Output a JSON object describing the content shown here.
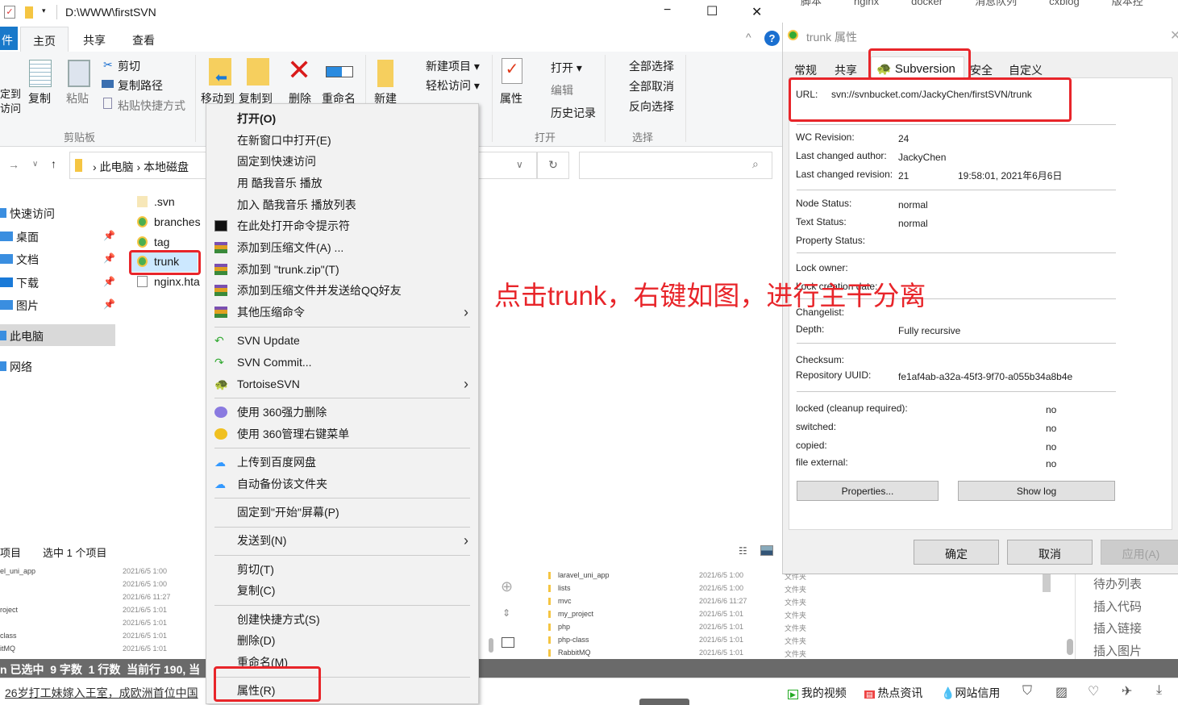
{
  "explorer": {
    "path_title": "D:\\WWW\\firstSVN",
    "window_controls": {
      "minimize": "−",
      "maximize": "☐",
      "close": "✕"
    },
    "tabs": [
      {
        "label": "件"
      },
      {
        "label": "主页"
      },
      {
        "label": "共享"
      },
      {
        "label": "查看"
      }
    ],
    "ribbon": {
      "pin_partial": "定到\n访问",
      "copy": "复制",
      "paste": "粘贴",
      "cut": "剪切",
      "copy_path": "复制路径",
      "paste_shortcut": "粘贴快捷方式",
      "clipboard_group": "剪贴板",
      "move_to": "移动到",
      "copy_to": "复制到",
      "delete": "删除",
      "rename": "重命名",
      "new_folder": "新建",
      "new_item": "新建项目 ▾",
      "easy_access": "轻松访问 ▾",
      "properties": "属性",
      "open": "打开 ▾",
      "edit": "编辑",
      "history": "历史记录",
      "open_group": "打开",
      "select_all": "全部选择",
      "select_none": "全部取消",
      "invert_selection": "反向选择",
      "select_group": "选择"
    },
    "address": {
      "crumbs": [
        "此电脑",
        "本地磁盘"
      ]
    },
    "nav": [
      {
        "label": "快速访问"
      },
      {
        "label": "桌面"
      },
      {
        "label": "文档"
      },
      {
        "label": "下载"
      },
      {
        "label": "图片"
      },
      {
        "label": "此电脑"
      },
      {
        "label": "网络"
      }
    ],
    "files": [
      {
        "name": ".svn"
      },
      {
        "name": "branches"
      },
      {
        "name": "tag"
      },
      {
        "name": "trunk"
      },
      {
        "name": "nginx.hta"
      }
    ],
    "status": {
      "items": "项目",
      "selected": "选中 1 个项目"
    }
  },
  "context_menu": [
    {
      "label": "打开(O)",
      "bold": true
    },
    {
      "label": "在新窗口中打开(E)"
    },
    {
      "label": "固定到快速访问"
    },
    {
      "label": "用 酷我音乐 播放"
    },
    {
      "label": "加入 酷我音乐 播放列表"
    },
    {
      "label": "在此处打开命令提示符",
      "icon": "cmd"
    },
    {
      "label": "添加到压缩文件(A) ...",
      "icon": "winrar"
    },
    {
      "label": "添加到 \"trunk.zip\"(T)",
      "icon": "winrar"
    },
    {
      "label": "添加到压缩文件并发送给QQ好友",
      "icon": "winrar"
    },
    {
      "label": "其他压缩命令",
      "icon": "winrar",
      "submenu": true
    },
    {
      "separator": true
    },
    {
      "label": "SVN Update",
      "icon": "svn-update"
    },
    {
      "label": "SVN Commit...",
      "icon": "svn-commit"
    },
    {
      "label": "TortoiseSVN",
      "icon": "tortoise",
      "submenu": true
    },
    {
      "separator": true
    },
    {
      "label": "使用 360强力删除",
      "icon": "360-delete"
    },
    {
      "label": "使用 360管理右键菜单",
      "icon": "360-plus"
    },
    {
      "separator": true
    },
    {
      "label": "上传到百度网盘",
      "icon": "baidu"
    },
    {
      "label": "自动备份该文件夹",
      "icon": "baidu"
    },
    {
      "separator": true
    },
    {
      "label": "固定到\"开始\"屏幕(P)"
    },
    {
      "separator": true
    },
    {
      "label": "发送到(N)",
      "submenu": true
    },
    {
      "separator": true
    },
    {
      "label": "剪切(T)"
    },
    {
      "label": "复制(C)"
    },
    {
      "separator": true
    },
    {
      "label": "创建快捷方式(S)"
    },
    {
      "label": "删除(D)"
    },
    {
      "label": "重命名(M)"
    },
    {
      "separator": true
    },
    {
      "label": "属性(R)"
    }
  ],
  "annotation": "点击trunk，右键如图，进行主干分离",
  "bookmarks": [
    "脚本",
    "nginx",
    "docker",
    "消息队列",
    "cxblog",
    "版本控"
  ],
  "properties_dialog": {
    "title": "trunk 属性",
    "tabs": [
      {
        "label": "常规"
      },
      {
        "label": "共享"
      },
      {
        "label": "Subversion"
      },
      {
        "label": "安全"
      },
      {
        "label": "自定义"
      }
    ],
    "url_label": "URL:",
    "url": "svn://svnbucket.com/JackyChen/firstSVN/trunk",
    "fields": {
      "wc_revision": {
        "label": "WC Revision:",
        "value": "24"
      },
      "last_author": {
        "label": "Last changed author:",
        "value": "JackyChen"
      },
      "last_revision": {
        "label": "Last changed revision:",
        "value": "21",
        "date": "19:58:01, 2021年6月6日"
      },
      "node_status": {
        "label": "Node Status:",
        "value": "normal"
      },
      "text_status": {
        "label": "Text Status:",
        "value": "normal"
      },
      "property_status": {
        "label": "Property Status:"
      },
      "lock_owner": {
        "label": "Lock owner:"
      },
      "lock_date": {
        "label": "Lock creation date:"
      },
      "changelist": {
        "label": "Changelist:"
      },
      "depth": {
        "label": "Depth:",
        "value": "Fully recursive"
      },
      "checksum": {
        "label": "Checksum:"
      },
      "uuid": {
        "label": "Repository UUID:",
        "value": "fe1af4ab-a32a-45f3-9f70-a055b34a8b4e"
      },
      "locked": {
        "label": "locked (cleanup required):",
        "value": "no"
      },
      "switched": {
        "label": "switched:",
        "value": "no"
      },
      "copied": {
        "label": "copied:",
        "value": "no"
      },
      "file_external": {
        "label": "file external:",
        "value": "no"
      }
    },
    "properties_button": "Properties...",
    "show_log_button": "Show log",
    "ok": "确定",
    "cancel": "取消",
    "apply": "应用(A)"
  },
  "background_left_list": [
    {
      "name": "el_uni_app",
      "date": "2021/6/5 1:00"
    },
    {
      "name": "",
      "date": "2021/6/5 1:00"
    },
    {
      "name": "",
      "date": "2021/6/6 11:27"
    },
    {
      "name": "roject",
      "date": "2021/6/5 1:01"
    },
    {
      "name": "",
      "date": "2021/6/5 1:01"
    },
    {
      "name": "class",
      "date": "2021/6/5 1:01"
    },
    {
      "name": "itMQ",
      "date": "2021/6/5 1:01"
    }
  ],
  "background_mid_list": [
    {
      "name": "laravel_uni_app",
      "date": "2021/6/5 1:00",
      "type": "文件夹"
    },
    {
      "name": "lists",
      "date": "2021/6/5 1:00",
      "type": "文件夹"
    },
    {
      "name": "mvc",
      "date": "2021/6/6 11:27",
      "type": "文件夹"
    },
    {
      "name": "my_project",
      "date": "2021/6/5 1:01",
      "type": "文件夹"
    },
    {
      "name": "php",
      "date": "2021/6/5 1:01",
      "type": "文件夹"
    },
    {
      "name": "php-class",
      "date": "2021/6/5 1:01",
      "type": "文件夹"
    },
    {
      "name": "RabbitMQ",
      "date": "2021/6/5 1:01",
      "type": "文件夹"
    }
  ],
  "editor_side_menu": [
    "待办列表",
    "插入代码",
    "插入链接",
    "插入图片"
  ],
  "editor_status": "n 已选中  9 字数  1 行数  当前行 190, 当",
  "browser_bar": {
    "news_link": "26岁打工妹嫁入王室，成欧洲首位中国",
    "items": [
      "我的视频",
      "热点资讯",
      "网站信用"
    ]
  },
  "colors": {
    "annotation_red": "#e8252a",
    "selected_blue": "#cce8ff",
    "file_tab_blue": "#1979ca"
  }
}
